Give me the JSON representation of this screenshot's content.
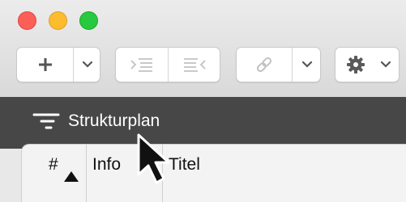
{
  "window": {
    "traffic_lights": {
      "close_color": "#fc5f57",
      "minimize_color": "#fdbc2e",
      "zoom_color": "#28c840"
    }
  },
  "toolbar": {
    "add_icon": "plus-icon",
    "dropdown_icon": "chevron-down-icon",
    "indent_icon": "indent-icon",
    "outdent_icon": "outdent-icon",
    "link_icon": "link-icon",
    "settings_icon": "gear-icon"
  },
  "view_bar": {
    "icon": "outline-icon",
    "label": "Strukturplan"
  },
  "table": {
    "columns": [
      {
        "label": "#",
        "sort": "ascending"
      },
      {
        "label": "Info"
      },
      {
        "label": "Titel"
      }
    ]
  },
  "cursor": "arrow-pointer"
}
